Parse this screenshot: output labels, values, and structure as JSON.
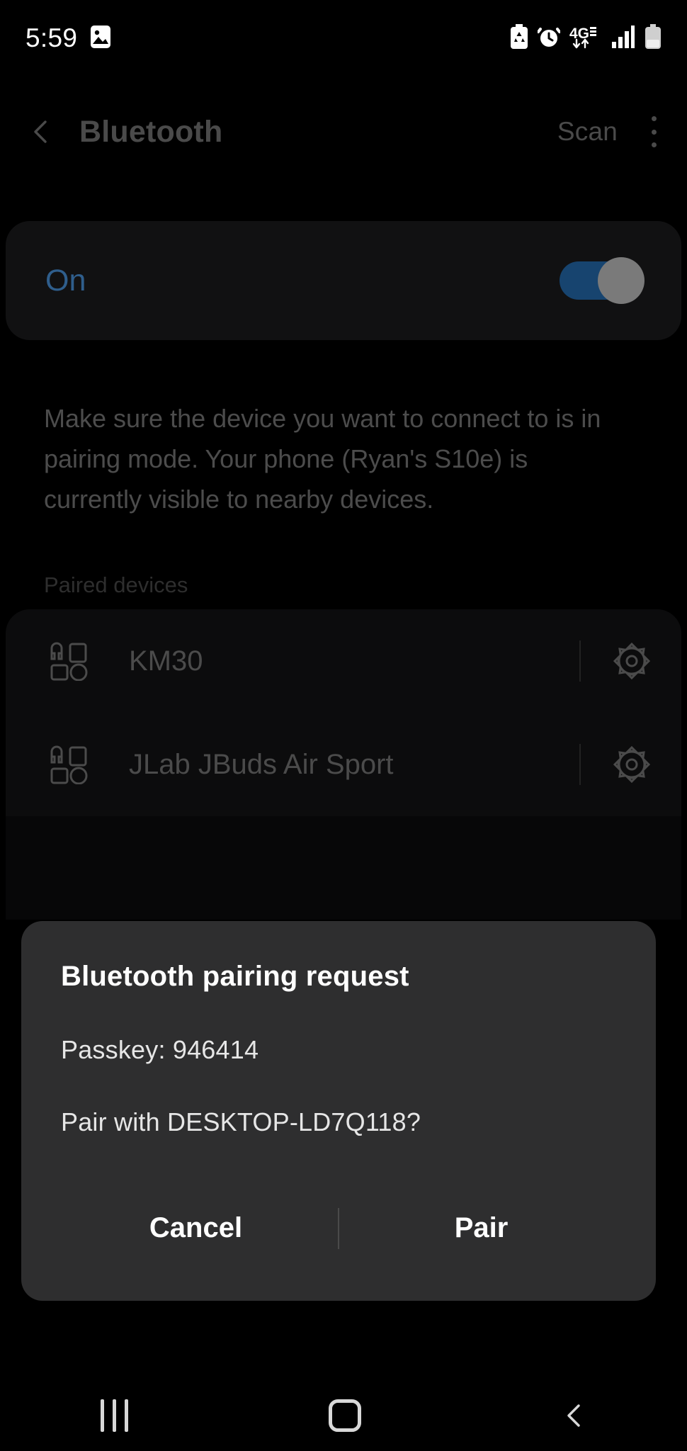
{
  "status_bar": {
    "time": "5:59",
    "left_icons": [
      {
        "name": "gallery-image-icon"
      }
    ],
    "right_icons": [
      {
        "name": "battery-saver-icon"
      },
      {
        "name": "alarm-icon"
      },
      {
        "name": "network-4g-lte-icon",
        "label": "4G"
      },
      {
        "name": "signal-bars-icon"
      },
      {
        "name": "battery-icon"
      }
    ]
  },
  "appbar": {
    "back_label": "back-icon",
    "title": "Bluetooth",
    "scan_label": "Scan",
    "overflow_label": "more-options"
  },
  "bluetooth_toggle": {
    "state_label": "On",
    "enabled": true,
    "track_color": "#17446f",
    "thumb_color": "#7a7a7a",
    "label_color": "#2f5e8c"
  },
  "hint_text": "Make sure the device you want to connect to is in pairing mode. Your phone (Ryan's S10e) is currently visible to nearby devices.",
  "paired_section": {
    "header": "Paired devices",
    "devices": [
      {
        "name": "KM30",
        "icon": "multi-device-icon",
        "settings_icon": "gear-icon"
      },
      {
        "name": "JLab JBuds Air Sport",
        "icon": "multi-device-icon",
        "settings_icon": "gear-icon"
      }
    ]
  },
  "dialog": {
    "title": "Bluetooth pairing request",
    "passkey_line": "Passkey: 946414",
    "pair_question": "Pair with DESKTOP-LD7Q118?",
    "cancel_label": "Cancel",
    "pair_label": "Pair",
    "background": "#2e2e2f"
  },
  "navbar": {
    "recents_label": "recents-icon",
    "home_label": "home-icon",
    "back_label": "back-icon"
  }
}
